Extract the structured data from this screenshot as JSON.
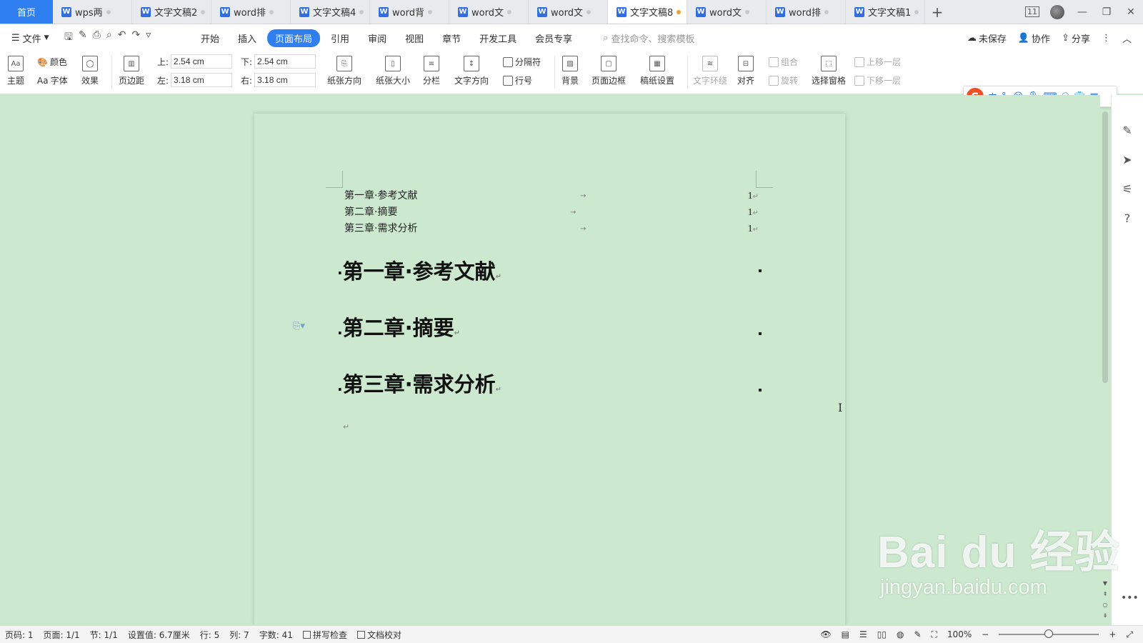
{
  "tabs": {
    "home": "首页",
    "docs": [
      {
        "label": "wps两",
        "active": false
      },
      {
        "label": "文字文稿2",
        "active": false
      },
      {
        "label": "word排",
        "active": false
      },
      {
        "label": "文字文稿4",
        "active": false
      },
      {
        "label": "word背",
        "active": false
      },
      {
        "label": "word文",
        "active": false
      },
      {
        "label": "word文",
        "active": false
      },
      {
        "label": "文字文稿8",
        "active": true
      },
      {
        "label": "word文",
        "active": false
      },
      {
        "label": "word排",
        "active": false
      },
      {
        "label": "文字文稿1",
        "active": false
      }
    ],
    "add": "+",
    "page_count": "11"
  },
  "menubar": {
    "file": "文件",
    "items": [
      "开始",
      "插入",
      "页面布局",
      "引用",
      "审阅",
      "视图",
      "章节",
      "开发工具",
      "会员专享"
    ],
    "active_item": "页面布局",
    "search_placeholder": "查找命令、搜索模板",
    "unsaved": "未保存",
    "collaborate": "协作",
    "share": "分享"
  },
  "ribbon": {
    "theme": "主题",
    "colors": "颜色",
    "fonts": "字体",
    "effects": "效果",
    "margins": "页边距",
    "margin_top_label": "上:",
    "margin_top": "2.54 cm",
    "margin_bottom_label": "下:",
    "margin_bottom": "2.54 cm",
    "margin_left_label": "左:",
    "margin_left": "3.18 cm",
    "margin_right_label": "右:",
    "margin_right": "3.18 cm",
    "orientation": "纸张方向",
    "size": "纸张大小",
    "columns": "分栏",
    "text_direction": "文字方向",
    "breaks": "分隔符",
    "line_numbers": "行号",
    "background": "背景",
    "page_border": "页面边框",
    "manuscript": "稿纸设置",
    "wrap_text": "文字环绕",
    "align": "对齐",
    "group": "组合",
    "rotate": "旋转",
    "selection_pane": "选择窗格",
    "bring_forward": "上移一层",
    "send_backward": "下移一层"
  },
  "ime": {
    "logo": "S",
    "mode": "中",
    "punct": "°,"
  },
  "document": {
    "toc": [
      {
        "title": "第一章·参考文献",
        "page": "1"
      },
      {
        "title": "第二章·摘要",
        "page": "1"
      },
      {
        "title": "第三章·需求分析",
        "page": "1"
      }
    ],
    "headings": [
      "第一章·参考文献",
      "第二章·摘要",
      "第三章·需求分析"
    ],
    "para_mark": "↵",
    "tab_mark": "→"
  },
  "statusbar": {
    "page_num": "页码: 1",
    "pages": "页面: 1/1",
    "section": "节: 1/1",
    "position": "设置值: 6.7厘米",
    "row": "行: 5",
    "col": "列: 7",
    "word_count": "字数: 41",
    "spell_check": "拼写检查",
    "proofread": "文档校对",
    "zoom": "100%"
  },
  "watermark": {
    "main": "Bai du 经验",
    "sub": "jingyan.baidu.com"
  },
  "colors": {
    "accent": "#2f7ff0",
    "page_bg": "#cce8cf",
    "unsaved_dot": "#f0a030"
  }
}
